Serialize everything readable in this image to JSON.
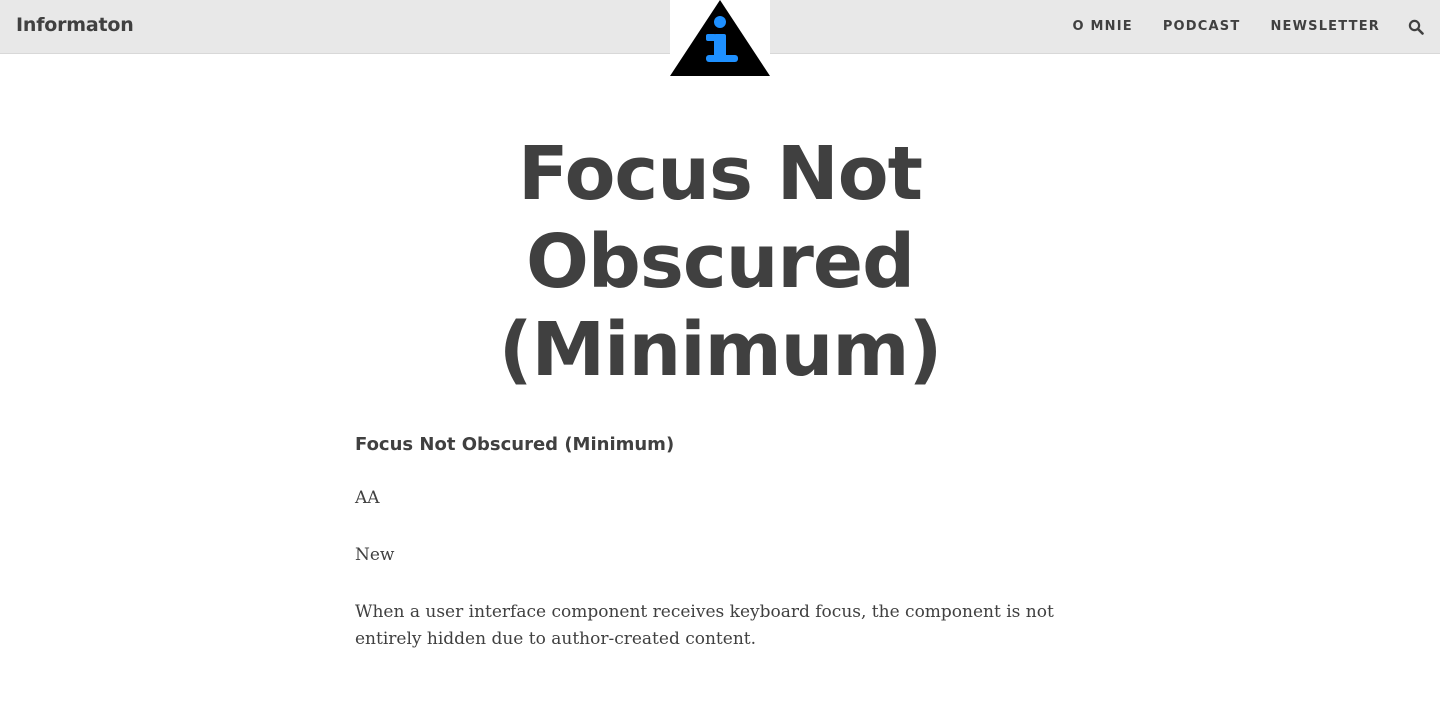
{
  "header": {
    "site_title": "Informaton",
    "logo": {
      "icon": "info-triangle-logo-icon",
      "accent": "#1E90FF"
    },
    "nav": [
      {
        "label": "O MNIE"
      },
      {
        "label": "PODCAST"
      },
      {
        "label": "NEWSLETTER"
      }
    ],
    "search_icon": "search-icon"
  },
  "post": {
    "title": "Focus Not Obscured (Minimum)",
    "subtitle": "Focus Not Obscured (Minimum)",
    "paragraphs": [
      "AA",
      "New",
      "When a user interface component receives keyboard focus, the component is not entirely hidden due to author-created content."
    ]
  },
  "colors": {
    "header_bg": "#E8E8E8",
    "text": "#404040",
    "logo_accent": "#1E90FF"
  }
}
